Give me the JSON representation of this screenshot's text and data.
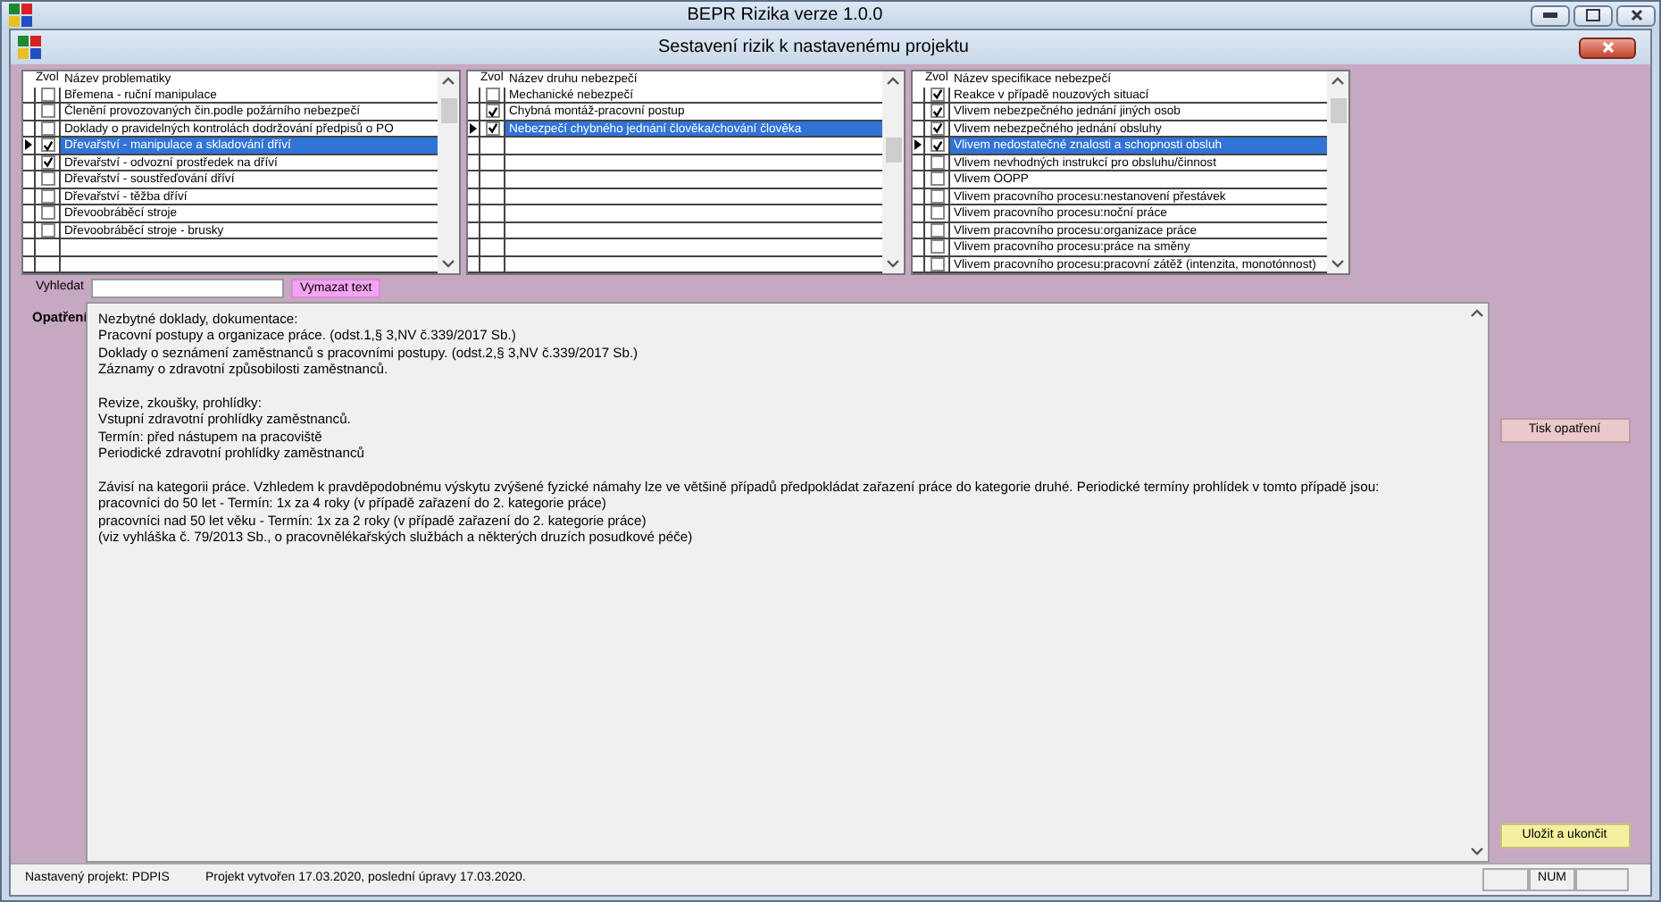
{
  "window": {
    "title": "BEPR Rizika verze 1.0.0"
  },
  "inner_window": {
    "title": "Sestavení rizik k nastavenému projektu"
  },
  "lists": [
    {
      "columns": [
        "Zvol",
        "Název problematiky"
      ],
      "rows": [
        {
          "label": "Břemena - ruční manipulace",
          "checked": false,
          "selected": false
        },
        {
          "label": "Členění provozovaných čin.podle požárního nebezpečí",
          "checked": false,
          "selected": false
        },
        {
          "label": "Doklady o pravidelných kontrolách dodržování předpisů o PO",
          "checked": false,
          "selected": false
        },
        {
          "label": "Dřevařství - manipulace a skladování dříví",
          "checked": true,
          "selected": true
        },
        {
          "label": "Dřevařství - odvozní prostředek na dříví",
          "checked": true,
          "selected": false
        },
        {
          "label": "Dřevařství - soustřeďování dříví",
          "checked": false,
          "selected": false
        },
        {
          "label": "Dřevařství - těžba dříví",
          "checked": false,
          "selected": false
        },
        {
          "label": "Dřevoobráběcí stroje",
          "checked": false,
          "selected": false
        },
        {
          "label": "Dřevoobráběcí stroje - brusky",
          "checked": false,
          "selected": false
        }
      ]
    },
    {
      "columns": [
        "Zvol",
        "Název druhu nebezpečí"
      ],
      "rows": [
        {
          "label": "Mechanické nebezpečí",
          "checked": false,
          "selected": false
        },
        {
          "label": "Chybná montáž-pracovní postup",
          "checked": true,
          "selected": false
        },
        {
          "label": "Nebezpečí chybného jednání člověka/chování člověka",
          "checked": true,
          "selected": true
        }
      ]
    },
    {
      "columns": [
        "Zvol",
        "Název specifikace nebezpečí"
      ],
      "rows": [
        {
          "label": "Reakce v případě nouzových situací",
          "checked": true,
          "selected": false
        },
        {
          "label": "Vlivem nebezpečného jednání jiných osob",
          "checked": true,
          "selected": false
        },
        {
          "label": "Vlivem nebezpečného jednání obsluhy",
          "checked": true,
          "selected": false
        },
        {
          "label": "Vlivem nedostatečné znalosti a schopnosti obsluh",
          "checked": true,
          "selected": true
        },
        {
          "label": "Vlivem nevhodných instrukcí pro obsluhu/činnost",
          "checked": false,
          "selected": false
        },
        {
          "label": "Vlivem OOPP",
          "checked": false,
          "selected": false
        },
        {
          "label": "Vlivem pracovního procesu:nestanovení přestávek",
          "checked": false,
          "selected": false
        },
        {
          "label": "Vlivem pracovního procesu:noční práce",
          "checked": false,
          "selected": false
        },
        {
          "label": "Vlivem pracovního procesu:organizace práce",
          "checked": false,
          "selected": false
        },
        {
          "label": "Vlivem pracovního procesu:práce na směny",
          "checked": false,
          "selected": false
        },
        {
          "label": "Vlivem pracovního procesu:pracovní zátěž (intenzita, monotónnost)",
          "checked": false,
          "selected": false
        }
      ]
    }
  ],
  "search": {
    "label": "Vyhledat",
    "button": "Vymazat text"
  },
  "measures": {
    "label": "Opatření",
    "blocks": [
      [
        "Nezbytné doklady, dokumentace:",
        "Pracovní postupy a organizace práce.   (odst.1,§ 3,NV č.339/2017 Sb.)",
        "Doklady o seznámení zaměstnanců s pracovními postupy.   (odst.2,§ 3,NV č.339/2017 Sb.)",
        "Záznamy o zdravotní způsobilosti zaměstnanců."
      ],
      [
        "Revize, zkoušky, prohlídky:",
        "Vstupní zdravotní prohlídky zaměstnanců.",
        "Termín: před nástupem na pracoviště",
        "Periodické zdravotní prohlídky zaměstnanců"
      ],
      [
        "Závisí na kategorii práce. Vzhledem k pravděpodobnému výskytu zvýšené fyzické námahy lze ve většině případů předpokládat zařazení práce do kategorie druhé. Periodické termíny prohlídek v tomto případě jsou:",
        "pracovníci do 50 let - Termín: 1x za 4 roky (v případě zařazení do 2. kategorie práce)",
        "pracovníci nad 50 let věku - Termín: 1x za 2 roky (v případě zařazení do 2. kategorie práce)",
        "(viz vyhláška č. 79/2013 Sb., o pracovnělékařských službách a některých druzích posudkové péče)"
      ]
    ]
  },
  "buttons": [
    "Tisk opatření",
    "Uložit a ukončit"
  ],
  "status_bar": [
    "Nastavený projekt: PDPIS",
    "Projekt vytvořen 17.03.2020, poslední úpravy 17.03.2020.",
    "NUM"
  ]
}
